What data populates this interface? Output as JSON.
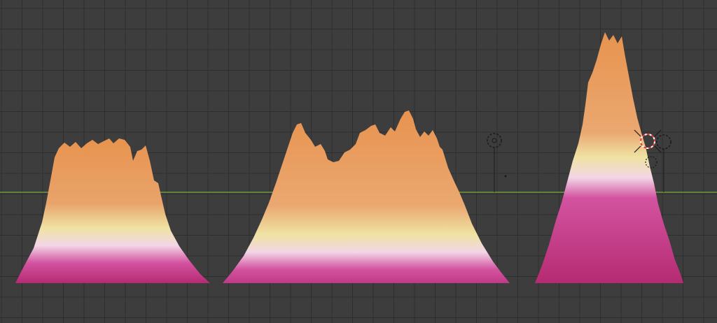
{
  "viewport": {
    "name": "3d-viewport",
    "background_color": "#3d3d3d",
    "grid_major_color": "#2e2e2e",
    "grid_minor_color": "#363636",
    "horizon_axis_color": "#6b9a3a"
  },
  "terrain_colors": {
    "peak": "#e89a5a",
    "upper": "#f0b07a",
    "middle": "#f0e4a0",
    "band": "#f3d2e4",
    "base": "#d04a96",
    "bottom": "#b02a70"
  },
  "objects": [
    {
      "name": "terrain-mesh-left",
      "selected": false
    },
    {
      "name": "terrain-mesh-center",
      "selected": false
    },
    {
      "name": "terrain-mesh-right",
      "selected": false
    },
    {
      "name": "light-empty",
      "selected": false
    },
    {
      "name": "3d-cursor",
      "selected": false
    }
  ]
}
